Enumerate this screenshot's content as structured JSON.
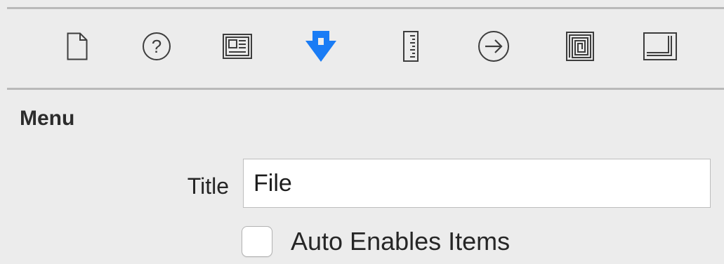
{
  "tabs": [
    {
      "name": "file-icon",
      "active": false
    },
    {
      "name": "help-icon",
      "active": false
    },
    {
      "name": "identity-icon",
      "active": false
    },
    {
      "name": "attributes-icon",
      "active": true
    },
    {
      "name": "size-ruler-icon",
      "active": false
    },
    {
      "name": "connections-arrow-icon",
      "active": false
    },
    {
      "name": "bindings-icon",
      "active": false
    },
    {
      "name": "view-effects-icon",
      "active": false
    }
  ],
  "colors": {
    "active_tab": "#1a7cf5",
    "icon": "#3d3d3d",
    "background": "#ececec"
  },
  "section": {
    "title": "Menu"
  },
  "title_field": {
    "label": "Title",
    "value": "File"
  },
  "auto_enables": {
    "label": "Auto Enables Items",
    "checked": false
  }
}
